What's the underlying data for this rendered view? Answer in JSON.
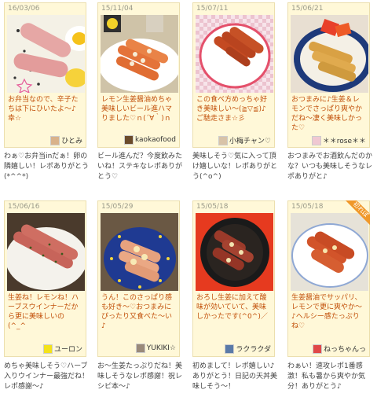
{
  "cards": [
    {
      "date": "16/03/06",
      "caption": "お弁当なので、辛子たちは下にひいたよ～♪幸☆",
      "author": "ひとみ",
      "comment": "わぁ♡お弁当inだぁ！卵の隣嬉しい！レポありがとう(*^^*)",
      "photo_icon": "bento-sausage-egg-photo"
    },
    {
      "date": "15/11/04",
      "caption": "レモン生姜醤油めちゃ美味しいビール進ハマりました♡ｎ(´∀｀)ｎ",
      "author": "kaokaofood",
      "comment": "ビール進んだ？今度飲みたいね！ステキなレポありがとう♡",
      "photo_icon": "sausage-lemon-plate-photo"
    },
    {
      "date": "15/07/11",
      "caption": "この食べ方めっちゃ好き美味しい～(≧▽≦)♪ご馳走さま☆彡",
      "author": "小梅チャン♡",
      "comment": "美味しそう♡気に入って頂け嬉しいな！レポありがとう(^o^)",
      "photo_icon": "sausages-red-plate-photo"
    },
    {
      "date": "15/06/21",
      "caption": "おつまみに♪生姜＆レモンでさっぱり爽やかだね～凄く美味しかった♡",
      "author": "＊＊rose＊＊",
      "comment": "おつまみでお酒飲んだのかな？いつも美味しそうなレポありがと♪",
      "photo_icon": "fried-snack-bowl-photo"
    },
    {
      "date": "15/06/16",
      "caption": "生姜ね！レモンね！ハーブスウインナーだから更に美味しいの(^_^",
      "author": "ユーロン",
      "comment": "めちゃ美味しそう♡ハーブ入りウインナー最強だね！レポ感謝～♪",
      "photo_icon": "herb-sausage-plate-photo"
    },
    {
      "date": "15/05/29",
      "caption": "うん！このさっぱり感も好き～♡おつまみにぴったり又食べた～い♪",
      "author": "YUKIKI☆",
      "comment": "お～生姜たっぷりだね！美味しそうなレポ感謝！祝レシピ本～♪",
      "photo_icon": "sausages-blue-plate-photo"
    },
    {
      "date": "15/05/18",
      "caption": "おろし生姜に加えて酸味が効いていて、美味しかったです(^0^)／",
      "author": "ラクラクダ",
      "comment": "初めまして！レポ嬉しい♪ありがとう！日記の天丼美味しそう～！",
      "photo_icon": "sausages-black-plate-photo"
    },
    {
      "date": "15/05/18",
      "caption": "生姜醤油でサッパリ、レモンで更に爽やか～♪ヘルシー感たっぷりね♡",
      "author": "ねっちゃんっ",
      "comment": "わぁい！速攻レポ1番感激！私も暑から爽やか気分！ありがとう♪",
      "photo_icon": "sausages-white-plate-photo",
      "badge": "初れぽ"
    }
  ],
  "colors": {
    "card_bg": "#fff8d8",
    "caption": "#c2500a",
    "badge": "#f0982a"
  }
}
